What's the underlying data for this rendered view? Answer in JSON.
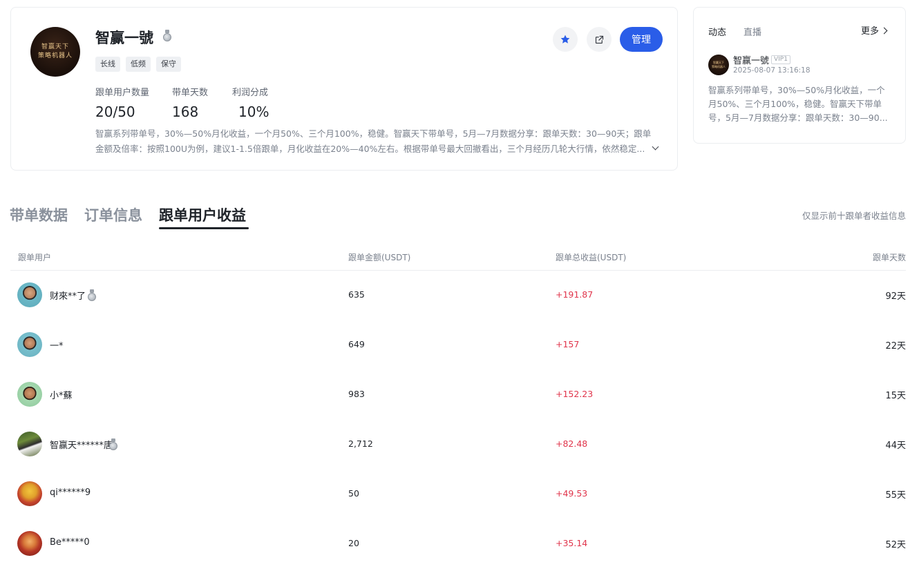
{
  "profile": {
    "avatar_lines": [
      "智赢天下",
      "策略机器人"
    ],
    "name": "智赢一號",
    "tags": [
      "长线",
      "低频",
      "保守"
    ],
    "stats": [
      {
        "label": "跟单用户数量",
        "value": "20/50"
      },
      {
        "label": "带单天数",
        "value": "168"
      },
      {
        "label": "利润分成",
        "value": "10%"
      }
    ],
    "description": "智赢系列带单号，30%—50%月化收益，一个月50%、三个月100%，稳健。智赢天下带单号，5月—7月数据分享：跟单天数：30—90天；跟单金额及倍率：按照100U为例，建议1-1.5倍跟单，月化收益在20%—40%左右。根据带单号最大回撤看出，三个月经历几轮大行情，依然稳定...",
    "manage_label": "管理",
    "icons": {
      "favorite": "star-icon",
      "share": "share-icon",
      "expand": "chevron-down-icon",
      "medal": "silver-medal-icon"
    },
    "accent_color": "#2a5de8"
  },
  "feed": {
    "tabs": [
      "动态",
      "直播"
    ],
    "more_label": "更多",
    "post": {
      "author": "智赢一號",
      "vip": "VIP1",
      "time": "2025-08-07 13:16:18",
      "content": "智赢系列带单号，30%—50%月化收益，一个月50%、三个月100%，稳健。智赢天下带单号，5月—7月数据分享：跟单天数：30—90..."
    }
  },
  "main": {
    "tabs": [
      "带单数据",
      "订单信息",
      "跟单用户收益"
    ],
    "active_tab": 2,
    "note": "仅显示前十跟单者收益信息",
    "table": {
      "headers": [
        "跟单用户",
        "跟单金额(USDT)",
        "跟单总收益(USDT)",
        "跟单天数"
      ],
      "rows": [
        {
          "name": "财來**了",
          "medal": true,
          "amount": "635",
          "profit": "+191.87",
          "days": "92天"
        },
        {
          "name": "一*",
          "medal": false,
          "amount": "649",
          "profit": "+157",
          "days": "22天"
        },
        {
          "name": "小*蘇",
          "medal": false,
          "amount": "983",
          "profit": "+152.23",
          "days": "15天"
        },
        {
          "name": "智赢天******唐",
          "medal": true,
          "amount": "2,712",
          "profit": "+82.48",
          "days": "44天"
        },
        {
          "name": "qi******9",
          "medal": false,
          "amount": "50",
          "profit": "+49.53",
          "days": "55天"
        },
        {
          "name": "Be*****0",
          "medal": false,
          "amount": "20",
          "profit": "+35.14",
          "days": "52天"
        }
      ],
      "profit_color": "#e0344b"
    }
  }
}
